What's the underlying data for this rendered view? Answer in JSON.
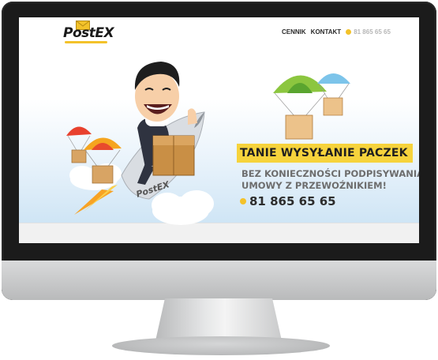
{
  "site": {
    "logo_text": "PostEX",
    "nav": {
      "items": [
        "CENNIK",
        "KONTAKT"
      ],
      "phone": "81 865 65 65"
    },
    "hero": {
      "headline": "TANIE WYSYŁANIE PACZEK",
      "subline_1": "BEZ KONIECZNOŚCI PODPISYWANIA",
      "subline_2": "UMOWY Z PRZEWOŹNIKIEM!",
      "phone": "81 865 65 65",
      "rocket_logo": "PostEX"
    }
  },
  "colors": {
    "accent": "#f6d33c",
    "text_dark": "#2d2d2d",
    "text_grey": "#6d6d6d",
    "sky": "#cfe5f5",
    "monitor_bezel": "#1b1b1b"
  },
  "icons": [
    "envelope-icon",
    "phone-icon"
  ]
}
